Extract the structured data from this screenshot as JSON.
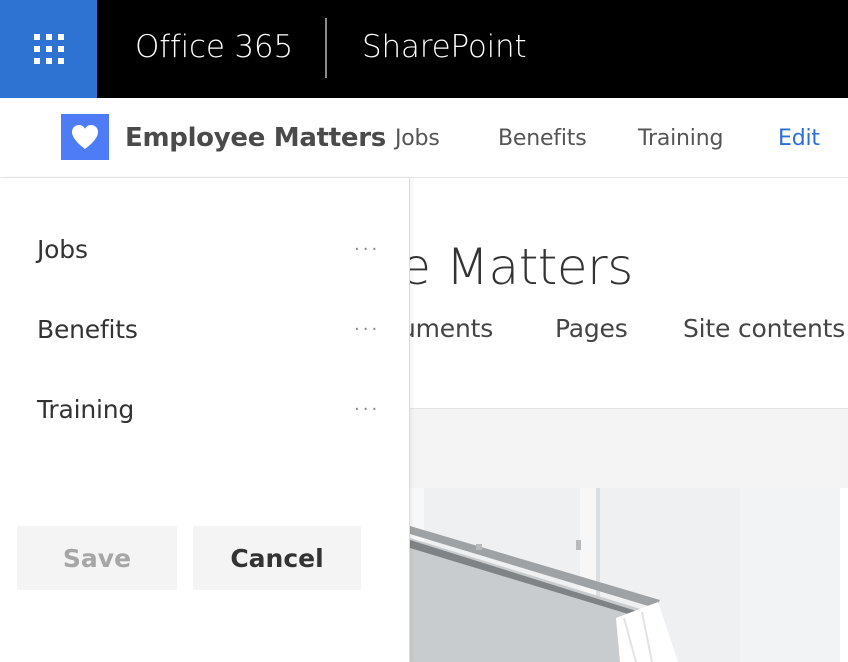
{
  "suite_bar": {
    "brand": "Office 365",
    "app": "SharePoint",
    "icons": {
      "launcher": "app-launcher-waffle-icon"
    },
    "colors": {
      "background": "#000000",
      "launcher_bg": "#2f73d2"
    }
  },
  "site_header": {
    "title": "Employee Matters",
    "logo_icon": "heart-icon",
    "logo_color": "#4d7cf6",
    "nav": [
      {
        "label": "Jobs"
      },
      {
        "label": "Benefits"
      },
      {
        "label": "Training"
      }
    ],
    "edit_label": "Edit",
    "edit_color": "#2b6fd6"
  },
  "main": {
    "page_title": "ee Matters",
    "subnav": [
      {
        "label": "uments"
      },
      {
        "label": "Pages"
      },
      {
        "label": "Site contents"
      }
    ]
  },
  "edit_panel": {
    "items": [
      {
        "label": "Jobs",
        "menu_icon": "more-ellipsis-icon"
      },
      {
        "label": "Benefits",
        "menu_icon": "more-ellipsis-icon"
      },
      {
        "label": "Training",
        "menu_icon": "more-ellipsis-icon"
      }
    ],
    "save_label": "Save",
    "cancel_label": "Cancel"
  }
}
